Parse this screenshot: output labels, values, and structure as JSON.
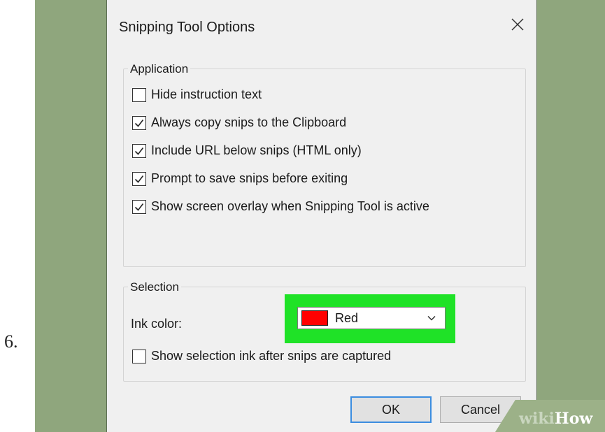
{
  "step": {
    "number": "6."
  },
  "dialog": {
    "title": "Snipping Tool Options",
    "close_icon": "close-icon"
  },
  "application": {
    "legend": "Application",
    "options": [
      {
        "label": "Hide instruction text",
        "checked": false
      },
      {
        "label": "Always copy snips to the Clipboard",
        "checked": true
      },
      {
        "label": "Include URL below snips (HTML only)",
        "checked": true
      },
      {
        "label": "Prompt to save snips before exiting",
        "checked": true
      },
      {
        "label": "Show screen overlay when Snipping Tool is active",
        "checked": true
      }
    ]
  },
  "selection": {
    "legend": "Selection",
    "ink_label": "Ink color:",
    "ink_value": "Red",
    "ink_swatch_color": "#ff0000",
    "highlight_color": "#1fe227",
    "show_ink_label": "Show selection ink after snips are captured",
    "show_ink_checked": false
  },
  "buttons": {
    "ok": "OK",
    "cancel": "Cancel"
  },
  "watermark": {
    "part1": "wiki",
    "part2": "How"
  }
}
